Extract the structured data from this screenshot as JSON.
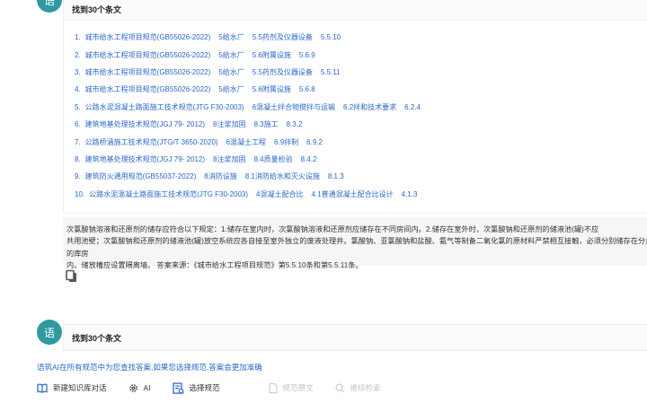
{
  "block1": {
    "avatar": "语",
    "title": "找到30个条文",
    "results": [
      {
        "n": "1.",
        "std": "城市给水工程项目规范(GB55026-2022)",
        "ch": "5给水厂",
        "sec": "5.5药剂及仪器设备",
        "clause": "5.5.10"
      },
      {
        "n": "2.",
        "std": "城市给水工程项目规范(GB55026-2022)",
        "ch": "5给水厂",
        "sec": "5.6附属设施",
        "clause": "5.6.9"
      },
      {
        "n": "3.",
        "std": "城市给水工程项目规范(GB55026-2022)",
        "ch": "5给水厂",
        "sec": "5.5药剂及仪器设备",
        "clause": "5.5.11"
      },
      {
        "n": "4.",
        "std": "城市给水工程项目规范(GB55026-2022)",
        "ch": "5给水厂",
        "sec": "5.6附属设施",
        "clause": "5.6.8"
      },
      {
        "n": "5.",
        "std": "公路水泥混凝土路面施工技术规范(JTG F30-2003)",
        "ch": "6混凝土拌合物搅拌与运输",
        "sec": "6.2拌和技术要求",
        "clause": "6.2.4"
      },
      {
        "n": "6.",
        "std": "建筑地基处理技术规范(JGJ 79- 2012)",
        "ch": "8注浆加固",
        "sec": "8.3施工",
        "clause": "8.3.2"
      },
      {
        "n": "7.",
        "std": "公路桥涵施工技术规范(JTG/T 3650-2020)",
        "ch": "6混凝土工程",
        "sec": "6.9拌制",
        "clause": "6.9.2"
      },
      {
        "n": "8.",
        "std": "建筑地基处理技术规范(JGJ 79- 2012)",
        "ch": "8注浆加固",
        "sec": "8.4质量检验",
        "clause": "8.4.2"
      },
      {
        "n": "9.",
        "std": "建筑防火通用规范(GB55037-2022)",
        "ch": "8消防设施",
        "sec": "8.1消防给水和灭火设施",
        "clause": "8.1.3"
      },
      {
        "n": "10.",
        "std": "公路水泥混凝土路面施工技术规范(JTG F30-2003)",
        "ch": "4混凝土配合比",
        "sec": "4.1普通混凝土配合比设计",
        "clause": "4.1.3"
      }
    ],
    "answer_lines": [
      "次氯酸钠溶液和还原剂的储存应符合以下规定：1.储存在室内时，次氯酸钠溶液和还原剂应储存在不同房间内。2.储存在室外时，次氯酸钠和还原剂的储液池(罐)不应",
      "共用池壁；次氯酸钠和还原剂的储液池(罐)放空系统应各自接至室外独立的废液处理井。氯酸钠、亚氯酸钠和盐酸、氨气等制备二氧化氯的原材料严禁相互接触，必须分别储存在分类的库房",
      "内。储放槽应设置隔离墙。 答案来源：《城市给水工程项目规范》第5.5.10条和第5.5.11条。"
    ]
  },
  "block2": {
    "avatar": "语",
    "title": "找到30个条文"
  },
  "hint": "语筑AI在所有规范中为您查找答案,如果您选择规范,答案会更加准确",
  "toolbar": {
    "new_chat": "新建知识库对话",
    "ai": "AI",
    "select_spec": "选择规范",
    "spec_original": "规范原文",
    "continue_search": "继续检索"
  }
}
